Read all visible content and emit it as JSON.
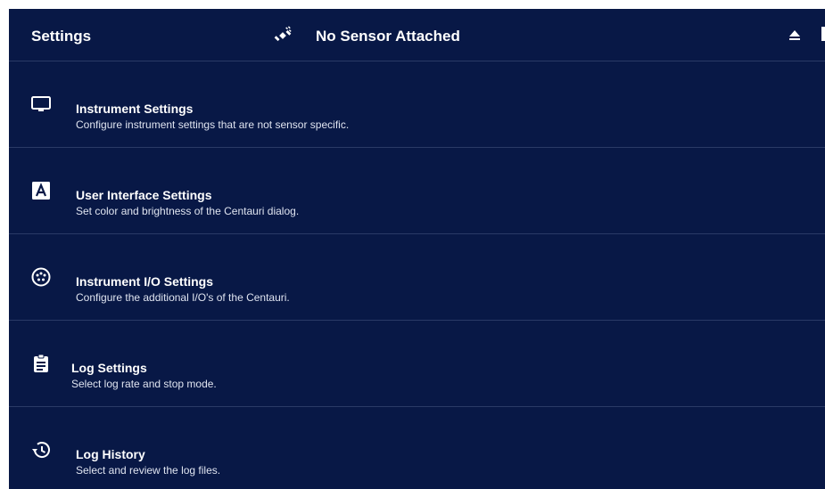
{
  "header": {
    "title": "Settings",
    "sensor_icon": "satellite-icon",
    "sensor_status": "No Sensor Attached",
    "eject_icon": "eject-icon"
  },
  "colors": {
    "background": "#081846",
    "divider": "#2a3a66",
    "text": "#ffffff",
    "subtext": "#dfe4f0"
  },
  "menu": {
    "items": [
      {
        "icon": "monitor-icon",
        "title": "Instrument Settings",
        "description": "Configure instrument settings that are not sensor specific."
      },
      {
        "icon": "font-a-icon",
        "title": "User Interface Settings",
        "description": "Set color and brightness of the Centauri dialog."
      },
      {
        "icon": "io-connector-icon",
        "title": "Instrument I/O Settings",
        "description": "Configure the additional I/O's of the Centauri."
      },
      {
        "icon": "clipboard-icon",
        "title": "Log Settings",
        "description": "Select log rate and stop mode."
      },
      {
        "icon": "history-icon",
        "title": "Log History",
        "description": "Select and review the log files."
      }
    ]
  }
}
